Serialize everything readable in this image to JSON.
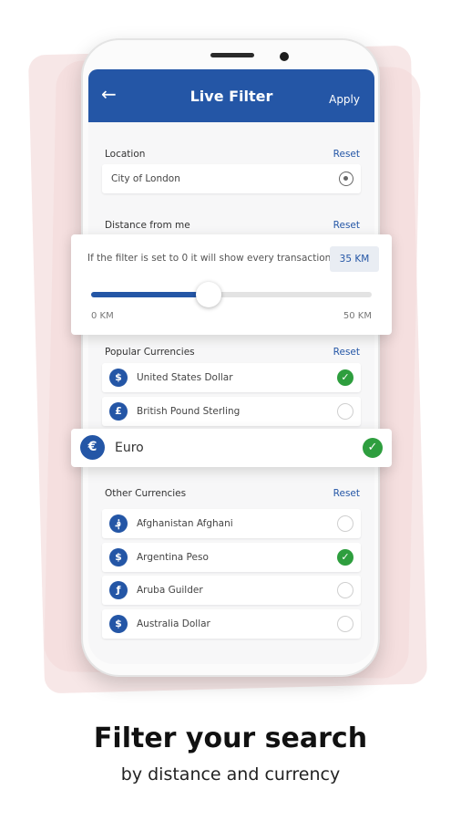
{
  "colors": {
    "primary": "#2456a6",
    "check": "#2e9e3e",
    "background_brush": "#f6e3e3"
  },
  "appbar": {
    "back_icon": "arrow-left-icon",
    "title": "Live Filter",
    "apply_label": "Apply"
  },
  "location": {
    "label": "Location",
    "reset_label": "Reset",
    "value": "City of London",
    "icon": "gps-target-icon"
  },
  "distance": {
    "label": "Distance from me",
    "reset_label": "Reset",
    "hint": "If the filter is set to 0 it will show every transaction",
    "value_label": "35 KM",
    "value_km": 35,
    "min_label": "0 KM",
    "max_label": "50 KM",
    "min_km": 0,
    "max_km": 50
  },
  "popular": {
    "label": "Popular Currencies",
    "reset_label": "Reset",
    "items": [
      {
        "symbol": "$",
        "name": "United States Dollar",
        "selected": true
      },
      {
        "symbol": "£",
        "name": "British Pound Sterling",
        "selected": false
      },
      {
        "symbol": "€",
        "name": "Euro",
        "selected": true
      }
    ]
  },
  "other": {
    "label": "Other Currencies",
    "reset_label": "Reset",
    "items": [
      {
        "symbol": "؋",
        "name": "Afghanistan Afghani",
        "selected": false
      },
      {
        "symbol": "$",
        "name": "Argentina Peso",
        "selected": true
      },
      {
        "symbol": "ƒ",
        "name": "Aruba Guilder",
        "selected": false
      },
      {
        "symbol": "$",
        "name": "Australia Dollar",
        "selected": false
      }
    ]
  },
  "footer": {
    "headline": "Filter your search",
    "subline": "by distance and currency"
  }
}
